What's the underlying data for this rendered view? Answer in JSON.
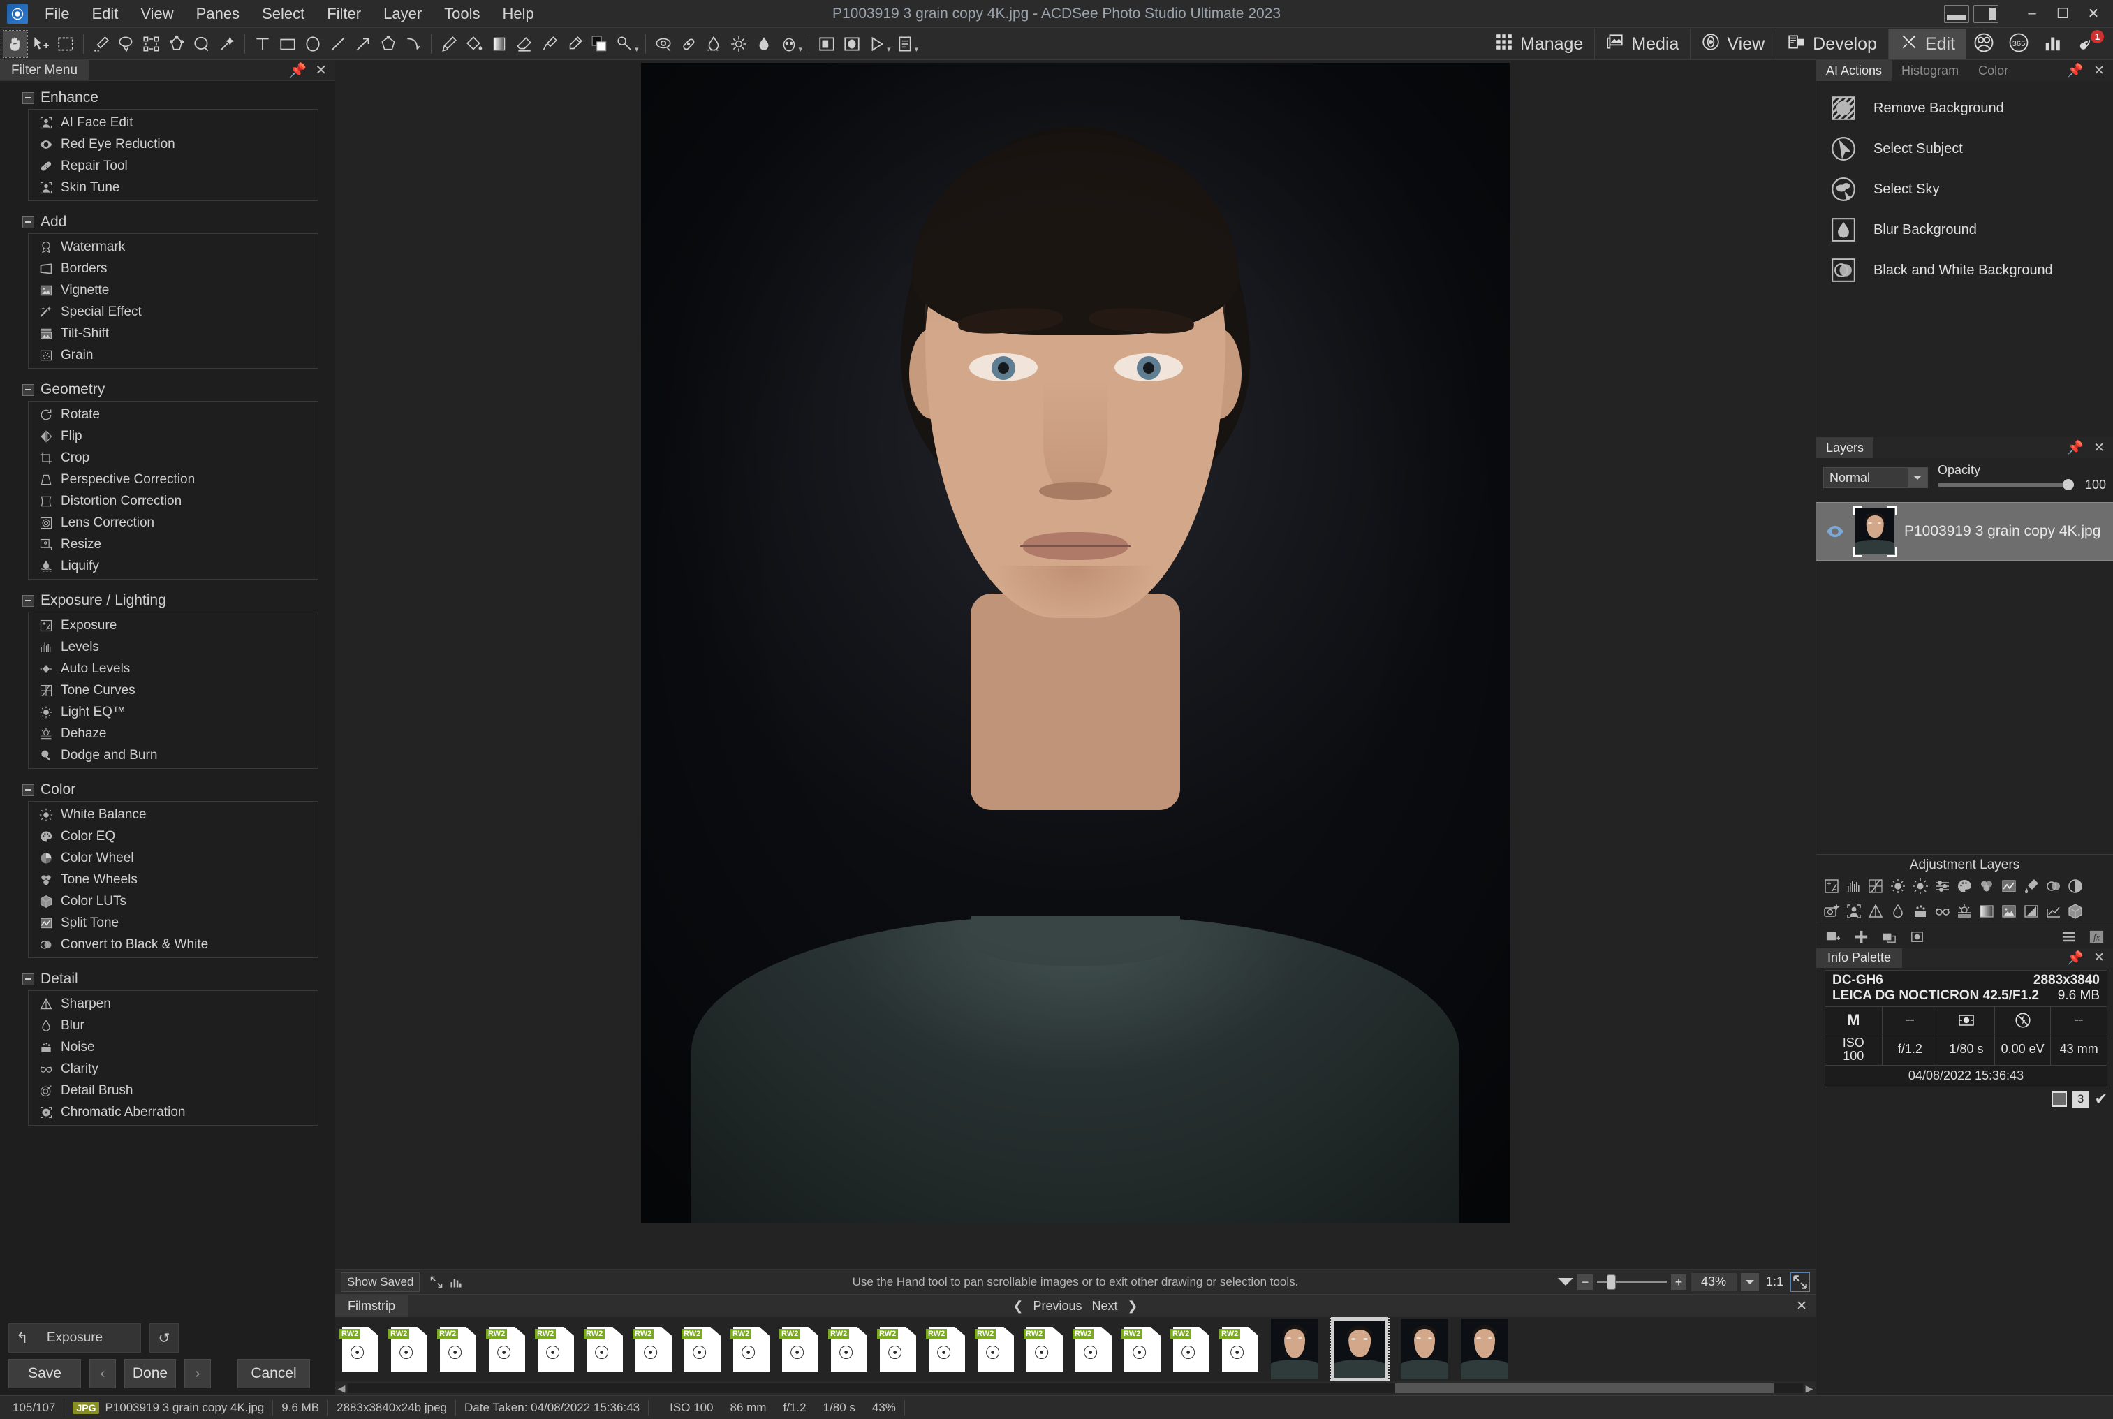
{
  "app": {
    "window_title": "P1003919 3 grain copy 4K.jpg - ACDSee Photo Studio Ultimate 2023",
    "logo_name": "acdsee-logo"
  },
  "menubar": {
    "items": [
      "File",
      "Edit",
      "View",
      "Panes",
      "Select",
      "Filter",
      "Layer",
      "Tools",
      "Help"
    ]
  },
  "window_controls": {
    "minimize": "–",
    "maximize": "☐",
    "close": "✕"
  },
  "modes": {
    "tabs": [
      {
        "label": "Manage",
        "icon": "grid-icon",
        "active": false
      },
      {
        "label": "Media",
        "icon": "media-icon",
        "active": false
      },
      {
        "label": "View",
        "icon": "eye-icon",
        "active": false
      },
      {
        "label": "Develop",
        "icon": "develop-icon",
        "active": false
      },
      {
        "label": "Edit",
        "icon": "edit-brush-icon",
        "active": true
      }
    ],
    "extra_icons": [
      {
        "name": "people-icon",
        "badge": ""
      },
      {
        "name": "365-icon",
        "badge": ""
      },
      {
        "name": "chart-icon",
        "badge": ""
      },
      {
        "name": "notifications-icon",
        "badge": "1"
      }
    ]
  },
  "left_panel": {
    "tab_label": "Filter Menu",
    "pin_icon": "pin-icon",
    "close_icon": "close-icon",
    "groups": [
      {
        "title": "Enhance",
        "items": [
          {
            "label": "AI Face Edit",
            "icon": "face-frame-icon"
          },
          {
            "label": "Red Eye Reduction",
            "icon": "eye-icon"
          },
          {
            "label": "Repair Tool",
            "icon": "bandage-icon"
          },
          {
            "label": "Skin Tune",
            "icon": "face-frame-icon"
          }
        ]
      },
      {
        "title": "Add",
        "items": [
          {
            "label": "Watermark",
            "icon": "seal-icon"
          },
          {
            "label": "Borders",
            "icon": "frame-icon"
          },
          {
            "label": "Vignette",
            "icon": "photo-icon"
          },
          {
            "label": "Special Effect",
            "icon": "sparkle-icon"
          },
          {
            "label": "Tilt-Shift",
            "icon": "tilt-shift-icon"
          },
          {
            "label": "Grain",
            "icon": "grain-icon"
          }
        ]
      },
      {
        "title": "Geometry",
        "items": [
          {
            "label": "Rotate",
            "icon": "rotate-icon"
          },
          {
            "label": "Flip",
            "icon": "flip-icon"
          },
          {
            "label": "Crop",
            "icon": "crop-icon"
          },
          {
            "label": "Perspective Correction",
            "icon": "perspective-icon"
          },
          {
            "label": "Distortion Correction",
            "icon": "distortion-icon"
          },
          {
            "label": "Lens Correction",
            "icon": "lens-icon"
          },
          {
            "label": "Resize",
            "icon": "resize-icon"
          },
          {
            "label": "Liquify",
            "icon": "liquify-icon"
          }
        ]
      },
      {
        "title": "Exposure / Lighting",
        "items": [
          {
            "label": "Exposure",
            "icon": "exposure-icon"
          },
          {
            "label": "Levels",
            "icon": "levels-icon"
          },
          {
            "label": "Auto Levels",
            "icon": "auto-levels-icon"
          },
          {
            "label": "Tone Curves",
            "icon": "tone-curves-icon"
          },
          {
            "label": "Light EQ™",
            "icon": "light-eq-icon"
          },
          {
            "label": "Dehaze",
            "icon": "dehaze-icon"
          },
          {
            "label": "Dodge and Burn",
            "icon": "dodge-burn-icon"
          }
        ]
      },
      {
        "title": "Color",
        "items": [
          {
            "label": "White Balance",
            "icon": "sun-icon"
          },
          {
            "label": "Color EQ",
            "icon": "palette-icon"
          },
          {
            "label": "Color Wheel",
            "icon": "color-wheel-icon"
          },
          {
            "label": "Tone Wheels",
            "icon": "tone-wheels-icon"
          },
          {
            "label": "Color LUTs",
            "icon": "cube-icon"
          },
          {
            "label": "Split Tone",
            "icon": "split-tone-icon"
          },
          {
            "label": "Convert to Black & White",
            "icon": "bw-icon"
          }
        ]
      },
      {
        "title": "Detail",
        "items": [
          {
            "label": "Sharpen",
            "icon": "sharpen-icon"
          },
          {
            "label": "Blur",
            "icon": "blur-drop-icon"
          },
          {
            "label": "Noise",
            "icon": "noise-icon"
          },
          {
            "label": "Clarity",
            "icon": "glasses-icon"
          },
          {
            "label": "Detail Brush",
            "icon": "detail-brush-icon"
          },
          {
            "label": "Chromatic Aberration",
            "icon": "chromatic-icon"
          }
        ]
      }
    ]
  },
  "left_actions": {
    "current_filter": "Exposure",
    "undo_icon": "undo-arrow-icon",
    "reset_icon": "reset-clock-icon",
    "save_label": "Save",
    "prev_label": "‹",
    "done_label": "Done",
    "next_label": "›",
    "cancel_label": "Cancel"
  },
  "canvas_status": {
    "show_saved_label": "Show Saved",
    "fullscreen_icon": "expand-icon",
    "histogram_icon": "histogram-icon",
    "hint": "Use the Hand tool to pan scrollable images or to exit other drawing or selection tools.",
    "zoom_value": "43%",
    "one_to_one": "1:1",
    "fit_icon": "fit-to-window-icon"
  },
  "filmstrip": {
    "tab_label": "Filmstrip",
    "previous_label": "Previous",
    "next_label": "Next",
    "close_icon": "close-icon",
    "raw_badge": "RW2",
    "placeholder_count": 19,
    "thumbnail_count": 4,
    "selected_thumbnail_index": 1
  },
  "right_panel": {
    "tabs": [
      {
        "label": "AI Actions",
        "active": true
      },
      {
        "label": "Histogram",
        "active": false
      },
      {
        "label": "Color",
        "active": false
      }
    ],
    "pin_icon": "pin-icon",
    "close_icon": "close-icon",
    "ai_actions": [
      {
        "label": "Remove Background",
        "icon": "remove-background-icon"
      },
      {
        "label": "Select Subject",
        "icon": "select-subject-icon"
      },
      {
        "label": "Select Sky",
        "icon": "select-sky-icon"
      },
      {
        "label": "Blur Background",
        "icon": "blur-background-icon"
      },
      {
        "label": "Black and White Background",
        "icon": "bw-background-icon"
      }
    ]
  },
  "layers": {
    "tab_label": "Layers",
    "pin_icon": "pin-icon",
    "close_icon": "close-icon",
    "blend_mode": "Normal",
    "opacity_label": "Opacity",
    "opacity_value": "100",
    "rows": [
      {
        "name": "P1003919 3 grain copy 4K.jpg",
        "visible": true,
        "selected": true
      }
    ]
  },
  "adjustment_layers": {
    "title": "Adjustment Layers",
    "row1_icons": [
      "exposure-icon",
      "levels-icon",
      "tone-curves-icon",
      "light-eq-icon",
      "white-balance-icon",
      "color-eq-icon",
      "palette-icon",
      "tone-wheels-icon",
      "split-tone-icon",
      "dropper-icon",
      "bw-icon",
      "contrast-icon"
    ],
    "row2_icons": [
      "photo-effect-icon",
      "skin-tune-icon",
      "sharpen-icon",
      "blur-drop-icon",
      "noise-icon",
      "clarity-icon",
      "dehaze-icon",
      "gradient-icon",
      "vignette-icon",
      "special-effect-icon",
      "curve-icon",
      "cube-icon"
    ],
    "bar_icons_left": [
      "add-layer-icon",
      "plus-icon",
      "duplicate-layer-icon",
      "mask-icon"
    ],
    "bar_icons_right": [
      "menu-icon",
      "fx-icon"
    ]
  },
  "info_palette": {
    "tab_label": "Info Palette",
    "pin_icon": "pin-icon",
    "close_icon": "close-icon",
    "camera": "DC-GH6",
    "dimensions": "2883x3840",
    "lens": "LEICA DG NOCTICRON 42.5/F1.2",
    "filesize": "9.6 MB",
    "mode": "M",
    "white_balance": "--",
    "metering_icon": "metering-icon",
    "flash_icon": "flash-off-icon",
    "extra": "--",
    "iso_label": "ISO",
    "iso_value": "100",
    "aperture": "f/1.2",
    "shutter": "1/80 s",
    "ev": "0.00 eV",
    "focal": "43 mm",
    "date": "04/08/2022 15:36:43",
    "footer_count": "3"
  },
  "statusbar": {
    "index": "105/107",
    "format_tag": "JPG",
    "filename": "P1003919 3 grain copy 4K.jpg",
    "filesize": "9.6 MB",
    "dimensions": "2883x3840x24b jpeg",
    "date_taken": "Date Taken: 04/08/2022 15:36:43",
    "iso": "ISO 100",
    "focal": "86 mm",
    "aperture": "f/1.2",
    "shutter": "1/80 s",
    "zoom": "43%"
  },
  "toolbar": {
    "tools": [
      {
        "name": "hand-tool",
        "selected": true
      },
      {
        "name": "move-tool",
        "selected": false
      },
      {
        "name": "marquee-select-tool",
        "selected": false
      },
      {
        "name": "freehand-select-tool",
        "selected": false
      },
      {
        "name": "lasso-select-tool",
        "selected": false
      },
      {
        "name": "smart-select-tool",
        "selected": false
      },
      {
        "name": "polygon-select-tool",
        "selected": false
      },
      {
        "name": "ellipse-select-tool",
        "selected": false
      },
      {
        "name": "magic-wand-tool",
        "selected": false
      },
      {
        "name": "text-tool",
        "selected": false
      },
      {
        "name": "rectangle-tool",
        "selected": false
      },
      {
        "name": "ellipse-tool",
        "selected": false
      },
      {
        "name": "line-tool",
        "selected": false
      },
      {
        "name": "arrow-tool",
        "selected": false
      },
      {
        "name": "polygon-tool",
        "selected": false
      },
      {
        "name": "curve-tool",
        "selected": false
      },
      {
        "name": "brush-tool",
        "selected": false
      },
      {
        "name": "fill-tool",
        "selected": false
      },
      {
        "name": "gradient-tool",
        "selected": false
      },
      {
        "name": "eraser-tool",
        "selected": false
      },
      {
        "name": "clone-tool",
        "selected": false
      },
      {
        "name": "dropper-tool",
        "selected": false
      },
      {
        "name": "color-swatch",
        "selected": false
      },
      {
        "name": "blur-tool",
        "selected": false
      },
      {
        "name": "burn-tool",
        "selected": false
      },
      {
        "name": "red-eye-tool",
        "selected": false
      },
      {
        "name": "sharpen-tool",
        "selected": false
      },
      {
        "name": "liquify-tool",
        "selected": false
      },
      {
        "name": "skin-tune-tool",
        "selected": false
      },
      {
        "name": "mask-rect-tool",
        "selected": false
      },
      {
        "name": "mask-ellipse-tool",
        "selected": false
      },
      {
        "name": "play-tool",
        "selected": false
      },
      {
        "name": "batch-tool",
        "selected": false
      }
    ]
  }
}
